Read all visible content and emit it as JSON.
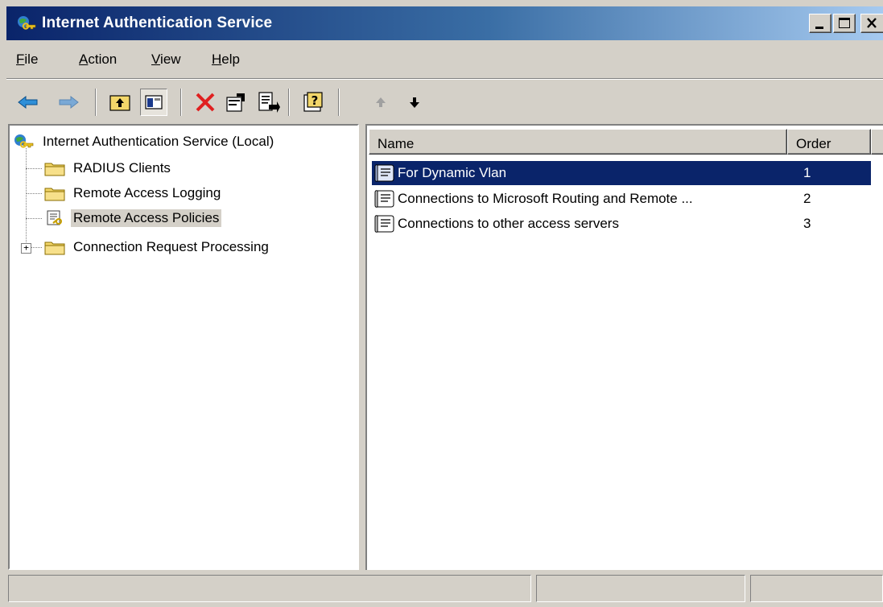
{
  "window": {
    "title": "Internet Authentication Service"
  },
  "menu": [
    {
      "label": "File",
      "accel": "F",
      "rest": "ile"
    },
    {
      "label": "Action",
      "accel": "A",
      "rest": "ction"
    },
    {
      "label": "View",
      "accel": "V",
      "rest": "iew"
    },
    {
      "label": "Help",
      "accel": "H",
      "rest": "elp"
    }
  ],
  "toolbar": {
    "buttons": [
      "back-arrow-icon",
      "forward-arrow-icon",
      "up-one-level-icon",
      "show-hide-tree-icon",
      "delete-icon",
      "properties-icon",
      "export-list-icon",
      "help-icon",
      "move-up-icon",
      "move-down-icon"
    ]
  },
  "tree": {
    "root": "Internet Authentication Service (Local)",
    "items": [
      "RADIUS Clients",
      "Remote Access Logging",
      "Remote Access Policies",
      "Connection Request Processing"
    ],
    "selected_index": 2
  },
  "list": {
    "columns": [
      "Name",
      "Order"
    ],
    "rows": [
      {
        "name": "For Dynamic Vlan",
        "order": "1"
      },
      {
        "name": "Connections to Microsoft Routing and Remote ...",
        "order": "2"
      },
      {
        "name": "Connections to other access servers",
        "order": "3"
      }
    ],
    "selected_index": 0
  },
  "colors": {
    "title_active": "#0a246a",
    "selection": "#0a246a",
    "face": "#d4d0c8"
  }
}
